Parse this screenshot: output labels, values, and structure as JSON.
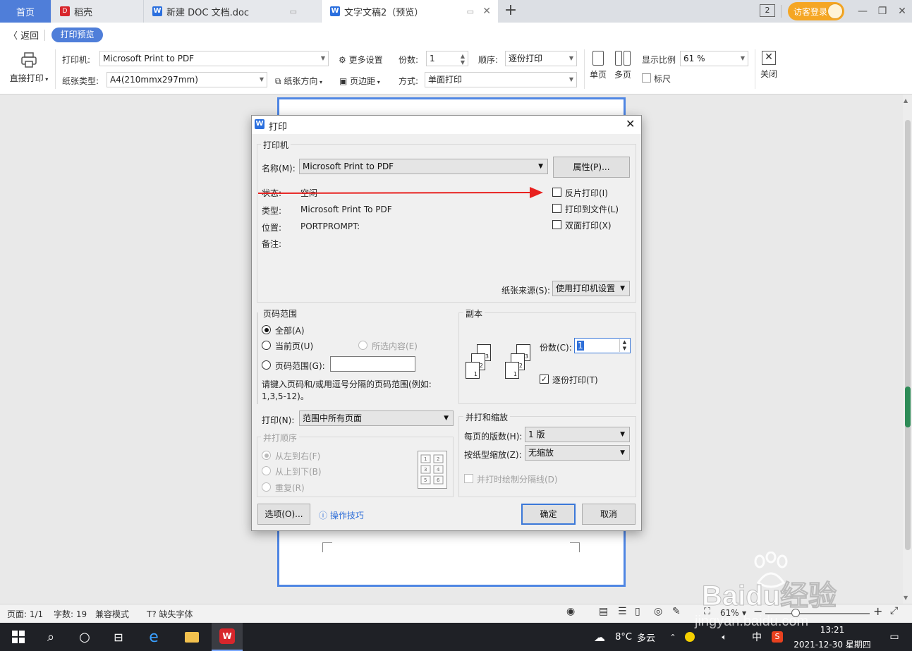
{
  "tabs": [
    {
      "label": "首页"
    },
    {
      "label": "稻壳"
    },
    {
      "label": "新建 DOC 文档.doc"
    },
    {
      "label": "文字文稿2（预览）"
    }
  ],
  "titlebar": {
    "window_count": "2",
    "login_label": "访客登录"
  },
  "toolbar2": {
    "back_label": "返回",
    "preview_label": "打印预览"
  },
  "ribbon": {
    "direct_print_label": "直接打印",
    "printer_label": "打印机:",
    "printer_value": "Microsoft Print to PDF",
    "more_settings_label": "更多设置",
    "copies_label": "份数:",
    "copies_value": "1",
    "order_label": "顺序:",
    "order_value": "逐份打印",
    "zoom_label": "显示比例",
    "zoom_value": "61 %",
    "paper_type_label": "纸张类型:",
    "paper_type_value": "A4(210mmx297mm)",
    "orientation_label": "纸张方向",
    "margins_label": "页边距",
    "mode_label": "方式:",
    "mode_value": "单面打印",
    "single_page_label": "单页",
    "multi_page_label": "多页",
    "ruler_label": "标尺",
    "close_label": "关闭"
  },
  "dialog": {
    "title": "打印",
    "printer_group": "打印机",
    "name_label": "名称(M):",
    "name_value": "Microsoft Print to PDF",
    "properties_button": "属性(P)...",
    "status_label": "状态:",
    "status_value": "空闲",
    "type_label": "类型:",
    "type_value": "Microsoft Print To PDF",
    "location_label": "位置:",
    "location_value": "PORTPROMPT:",
    "comment_label": "备注:",
    "reverse_print": "反片打印(I)",
    "print_to_file": "打印到文件(L)",
    "duplex_print": "双面打印(X)",
    "paper_source_label": "纸张来源(S):",
    "paper_source_value": "使用打印机设置",
    "page_range_group": "页码范围",
    "all_label": "全部(A)",
    "current_page_label": "当前页(U)",
    "selection_label": "所选内容(E)",
    "page_range_label": "页码范围(G):",
    "page_range_hint_line1": "请键入页码和/或用逗号分隔的页码范围(例如:",
    "page_range_hint_line2": "1,3,5-12)。",
    "copies_group": "副本",
    "copies_label": "份数(C):",
    "copies_value": "1",
    "collate_label": "逐份打印(T)",
    "print_label": "打印(N):",
    "print_value": "范围中所有页面",
    "order_group": "并打顺序",
    "left_to_right": "从左到右(F)",
    "top_to_bottom": "从上到下(B)",
    "repeat": "重复(R)",
    "scale_group": "并打和缩放",
    "pages_per_sheet_label": "每页的版数(H):",
    "pages_per_sheet_value": "1 版",
    "scale_label": "按纸型缩放(Z):",
    "scale_value": "无缩放",
    "draw_lines_label": "并打时绘制分隔线(D)",
    "options_button": "选项(O)...",
    "tips_label": "操作技巧",
    "ok_button": "确定",
    "cancel_button": "取消"
  },
  "statusbar": {
    "page": "页面: 1/1",
    "words": "字数: 19",
    "compat": "兼容模式",
    "missing_font": "缺失字体",
    "zoom": "61%"
  },
  "taskbar": {
    "weather_temp": "8°C",
    "weather_desc": "多云",
    "ime": "中",
    "time": "13:21",
    "date": "2021-12-30 星期四"
  },
  "watermark": {
    "brand": "Baidu经验",
    "url": "jingyan.baidu.com"
  },
  "colors": {
    "accent": "#4f7ed9",
    "arrow": "#e8211f",
    "login": "#f5a623"
  }
}
